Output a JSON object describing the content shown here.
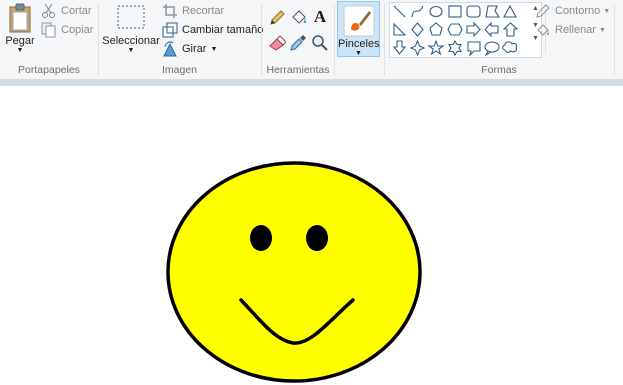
{
  "clipboard": {
    "paste_label": "Pegar",
    "cut_label": "Cortar",
    "copy_label": "Copiar",
    "group_label": "Portapapeles"
  },
  "image": {
    "select_label": "Seleccionar",
    "crop_label": "Recortar",
    "resize_label": "Cambiar tamaño",
    "rotate_label": "Girar",
    "group_label": "Imagen"
  },
  "tools": {
    "group_label": "Herramientas",
    "icons": [
      "pencil-icon",
      "fill-bucket-icon",
      "text-icon",
      "eraser-icon",
      "color-picker-icon",
      "magnifier-icon"
    ]
  },
  "brushes": {
    "label": "Pinceles",
    "active_color": "#cce4f7"
  },
  "shapes": {
    "group_label": "Formas",
    "outline_label": "Contorno",
    "fill_label": "Rellenar",
    "icons": [
      "line-icon",
      "curve-icon",
      "oval-icon",
      "rectangle-icon",
      "rounded-rectangle-icon",
      "polygon-icon",
      "triangle-icon",
      "right-triangle-icon",
      "diamond-icon",
      "pentagon-icon",
      "hexagon-icon",
      "right-arrow-icon",
      "left-arrow-icon",
      "up-arrow-icon",
      "down-arrow-icon",
      "four-point-star-icon",
      "five-point-star-icon",
      "six-point-star-icon",
      "rounded-callout-icon",
      "oval-callout-icon",
      "cloud-callout-icon"
    ]
  },
  "canvas": {
    "face_color": "#ffff00",
    "outline_color": "#000000"
  }
}
